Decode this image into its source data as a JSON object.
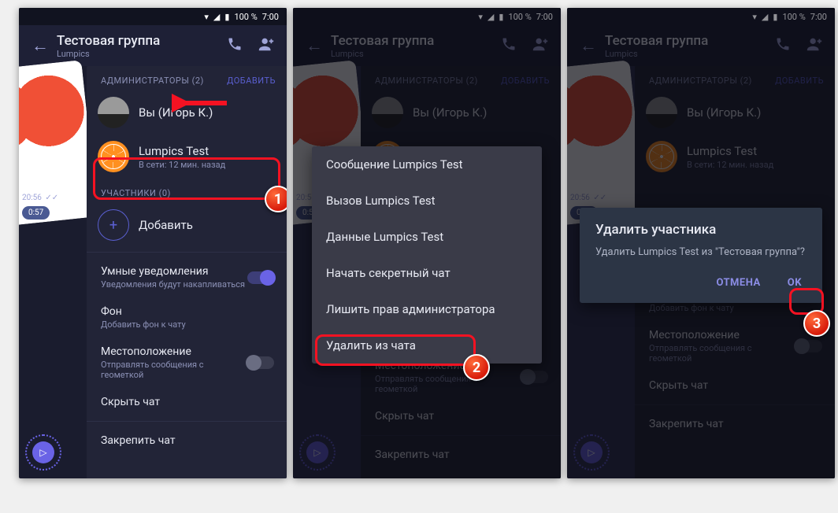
{
  "status": {
    "battery": "100 %",
    "time": "7:00"
  },
  "header": {
    "title": "Тестовая группа",
    "subtitle": "Lumpics"
  },
  "sections": {
    "admins_label": "АДМИНИСТРАТОРЫ (2)",
    "add_action": "ДОБАВИТЬ",
    "members_label": "УЧАСТНИКИ (0)",
    "add_member": "Добавить"
  },
  "admins": [
    {
      "name": "Вы (Игорь К.)",
      "sub": ""
    },
    {
      "name": "Lumpics Test",
      "sub": "В сети: 12 мин. назад"
    }
  ],
  "chat_time": "20:56",
  "voice_time": "0:57",
  "settings": {
    "smart_title": "Умные уведомления",
    "smart_sub": "Уведомления будут накапливаться",
    "bg_title": "Фон",
    "bg_sub": "Добавить фон к чату",
    "loc_title": "Местоположение",
    "loc_sub": "Отправлять сообщения с геометкой",
    "hide_title": "Скрыть чат",
    "pin_title": "Закрепить чат"
  },
  "context_menu": {
    "msg": "Сообщение Lumpics Test",
    "call": "Вызов Lumpics Test",
    "info": "Данные Lumpics Test",
    "secret": "Начать секретный чат",
    "revoke": "Лишить прав администратора",
    "remove": "Удалить из чата"
  },
  "dialog": {
    "title": "Удалить участника",
    "body": "Удалить Lumpics Test из \"Тестовая группа\"?",
    "cancel": "ОТМЕНА",
    "ok": "OK"
  }
}
